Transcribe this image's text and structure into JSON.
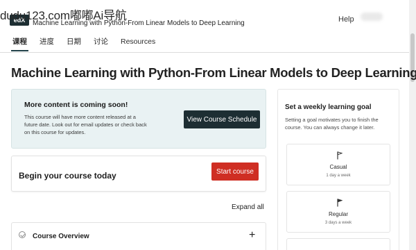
{
  "watermark": "dudu123.com嘟嘟Ai导航",
  "header": {
    "logo_text": "edX",
    "course_title": "Machine Learning with Python-From Linear Models to Deep Learning",
    "help_label": "Help"
  },
  "tabs": [
    {
      "label": "课程",
      "active": true
    },
    {
      "label": "进度",
      "active": false
    },
    {
      "label": "日期",
      "active": false
    },
    {
      "label": "讨论",
      "active": false
    },
    {
      "label": "Resources",
      "active": false
    }
  ],
  "main": {
    "page_title": "Machine Learning with Python-From Linear Models to Deep Learning",
    "notice": {
      "heading": "More content is coming soon!",
      "body": "This course will have more content released at a future date. Look out for email updates or check back on this course for updates.",
      "button_label": "View Course Schedule"
    },
    "begin": {
      "text": "Begin your course today",
      "button_label": "Start course"
    },
    "expand_all_label": "Expand all",
    "sections": [
      {
        "label": "Course Overview"
      }
    ]
  },
  "goal_panel": {
    "title": "Set a weekly learning goal",
    "description": "Setting a goal motivates you to finish the course. You can always change it later.",
    "options": [
      {
        "name": "Casual",
        "sub": "1 day a week"
      },
      {
        "name": "Regular",
        "sub": "3 days a week"
      }
    ]
  },
  "colors": {
    "primary_dark": "#1d2e33",
    "start_red": "#cf2e23",
    "notice_bg": "#e9f2f3"
  }
}
